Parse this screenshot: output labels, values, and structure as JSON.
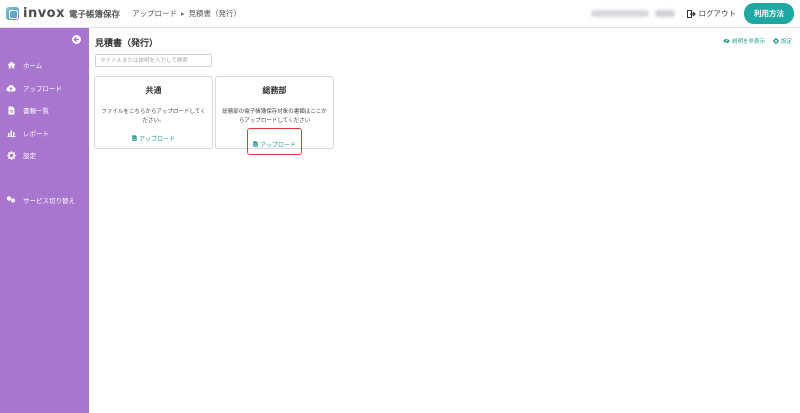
{
  "header": {
    "logo_text": "invox",
    "logo_subtitle": "電子帳簿保存",
    "breadcrumb": [
      "アップロード",
      "見積書（発行）"
    ],
    "logout_label": "ログアウト",
    "help_label": "利用方法"
  },
  "sidebar": {
    "items": [
      {
        "label": "ホーム",
        "icon": "home-icon"
      },
      {
        "label": "アップロード",
        "icon": "cloud-upload-icon"
      },
      {
        "label": "書類一覧",
        "icon": "document-icon"
      },
      {
        "label": "レポート",
        "icon": "bar-chart-icon"
      },
      {
        "label": "設定",
        "icon": "gear-icon"
      }
    ],
    "service_switch": {
      "label": "サービス切り替え",
      "icon": "switch-icon"
    }
  },
  "main": {
    "title": "見積書（発行）",
    "hide_desc_label": "説明を非表示",
    "settings_label": "設定",
    "search_placeholder": "タイトルまたは説明を入力して検索",
    "cards": [
      {
        "title": "共通",
        "description": "ファイルをこちらからアップロードしてください。",
        "upload_label": "アップロード"
      },
      {
        "title": "総務部",
        "description": "総務部の電子帳簿保存対象の書類はここからアップロードしてください",
        "upload_label": "アップロード"
      }
    ]
  },
  "colors": {
    "sidebar": "#a875cf",
    "accent": "#1fa7a1",
    "highlight": "#e0393e"
  }
}
